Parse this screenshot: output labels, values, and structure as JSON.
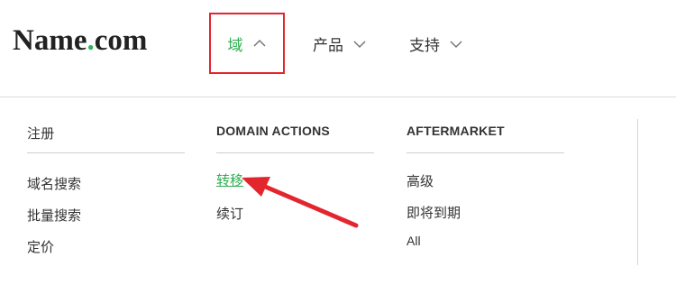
{
  "header": {
    "logo": {
      "name": "Name",
      "dot": ".",
      "tld": "com"
    },
    "nav": [
      {
        "label": "域",
        "state": "expanded"
      },
      {
        "label": "产品"
      },
      {
        "label": "支持"
      }
    ]
  },
  "dropdown": {
    "col1": {
      "title": "注册",
      "items": [
        "域名搜索",
        "批量搜索",
        "定价"
      ]
    },
    "col2": {
      "title": "DOMAIN ACTIONS",
      "items": [
        "转移",
        "续订"
      ]
    },
    "col3": {
      "title": "AFTERMARKET",
      "items": [
        "高级",
        "即将到期",
        "All"
      ]
    }
  },
  "colors": {
    "accent": "#2fae50",
    "highlight_box": "#e3262e",
    "arrow": "#e3262e"
  }
}
